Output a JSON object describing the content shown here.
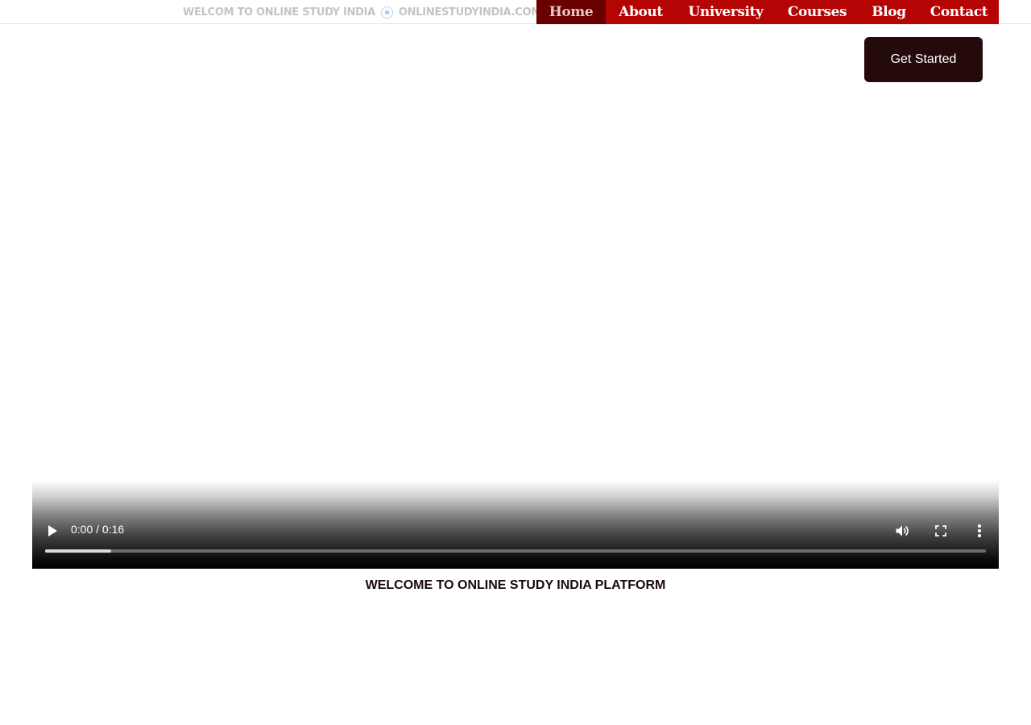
{
  "topbar": {
    "welcome_text": "WELCOM TO ONLINE STUDY INDIA",
    "site_text": "ONLINESTUDYINDIA.COM",
    "separator_icon": "globe-icon"
  },
  "nav": {
    "items": [
      {
        "label": "Home",
        "active": true
      },
      {
        "label": "About",
        "active": false
      },
      {
        "label": "University",
        "active": false
      },
      {
        "label": "Courses",
        "active": false
      },
      {
        "label": "Blog",
        "active": false
      },
      {
        "label": "Contact",
        "active": false
      }
    ],
    "colors": {
      "bar": "#b50404",
      "active": "#6b0000"
    }
  },
  "cta": {
    "label": "Get Started",
    "color": "#240a0b"
  },
  "video": {
    "time": "0:00 / 0:16",
    "buffered_fraction": 0.07,
    "icons": [
      "play-icon",
      "volume-icon",
      "fullscreen-icon",
      "more-options-icon"
    ]
  },
  "main": {
    "headline": "WELCOME TO ONLINE STUDY INDIA PLATFORM"
  }
}
